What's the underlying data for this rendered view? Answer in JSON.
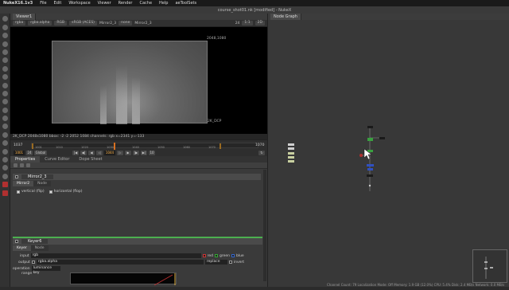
{
  "menubar": {
    "app": "NukeX16.1v3",
    "items": [
      "File",
      "Edit",
      "Workspace",
      "Viewer",
      "Render",
      "Cache",
      "Help",
      "aeToolSets"
    ],
    "right": ""
  },
  "titlebar": {
    "text": "course_shot01.nk [modified] - NukeX"
  },
  "viewer": {
    "tab": "Viewer1",
    "bar1": [
      "rgba",
      "rgba.alpha",
      "RGB",
      "sRGB (ACES)",
      "Mirror2_3",
      "none",
      "Mirror2_3"
    ],
    "zoom": "1:1",
    "fps": "24",
    "proxy": "2D",
    "corner_top": "2048,1080",
    "corner_bottom": "2K_DCP",
    "info": "2K_DCP 2048x1080  bbox: -2 -2 2052 1084 channels: rgb  x=2341 y=-133",
    "frame": "1044",
    "ruler_start": "1037",
    "ruler_end": "1070",
    "ruler_nums": [
      "1001",
      "1010",
      "1020",
      "1030",
      "1040",
      "1050",
      "1060",
      "1070"
    ],
    "global_label": "Global",
    "fstep": "10",
    "left_field": "1001",
    "right_field": "24"
  },
  "properties": {
    "tabs": [
      "Properties",
      "Curve Editor",
      "Dope Sheet"
    ],
    "active_tab": "Properties",
    "node1": {
      "name": "Mirror2_3",
      "subtabs": [
        "Mirror2",
        "Node"
      ],
      "vertical_label": "vertical (flip)",
      "horizontal_label": "horizontal (flop)"
    },
    "node2": {
      "name": "Keyer6",
      "subtabs": [
        "Keyer",
        "Node"
      ],
      "input_label": "input",
      "input_value": "rgb",
      "red_label": "red",
      "green_label": "green",
      "blue_label": "blue",
      "output_label": "output",
      "output_value": "rgba.alpha",
      "mode_value": "replace",
      "invert_label": "invert",
      "operation_label": "operation",
      "operation_value": "luminance key",
      "range_label": "range"
    }
  },
  "nodegraph": {
    "tab": "Node Graph",
    "status": "Channel Count: 79  Localization Mode: Off  Memory: 1.9 GB (12.0%)  CPU: 5.4%  Disk: 2.4 MB/s  Network: 0.0 MB/s"
  },
  "colors": {
    "accent": "#d87020",
    "node_green": "#3aa040",
    "node_blue": "#3050c0",
    "node_red": "#b03030"
  }
}
